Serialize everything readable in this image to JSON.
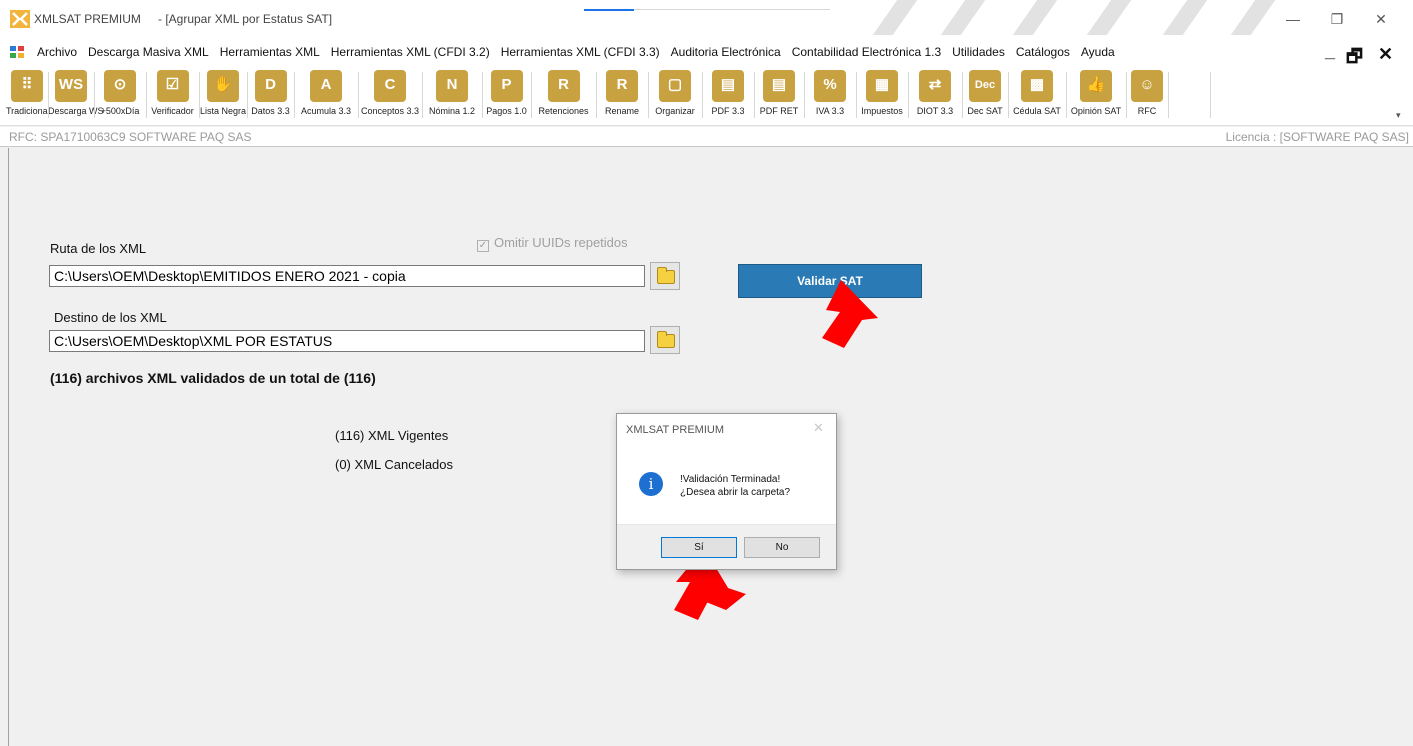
{
  "window": {
    "app_name": "XMLSAT PREMIUM",
    "doc_title": "- [Agrupar  XML por Estatus SAT]",
    "min_glyph": "—",
    "max_glyph": "❐",
    "close_glyph": "✕"
  },
  "menu": {
    "items": [
      "Archivo",
      "Descarga Masiva XML",
      "Herramientas XML",
      "Herramientas XML (CFDI 3.2)",
      "Herramientas XML (CFDI 3.3)",
      "Auditoria Electrónica",
      "Contabilidad Electrónica 1.3",
      "Utilidades",
      "Catálogos",
      "Ayuda"
    ],
    "mdi_min": "_",
    "mdi_max": "🗗",
    "mdi_close": "✕"
  },
  "toolbar": {
    "accent": "#c8a141",
    "buttons": [
      {
        "label": "Tradicional",
        "glyph": "⠿",
        "icon": "grid-icon"
      },
      {
        "label": "Descarga WS",
        "glyph": "WS",
        "icon": "ws-download-icon"
      },
      {
        "label": "+500xDía",
        "glyph": "⊙",
        "icon": "counter-icon"
      },
      {
        "label": "Verificador",
        "glyph": "☑",
        "icon": "checkbox-icon"
      },
      {
        "label": "Lista Negra",
        "glyph": "✋",
        "icon": "hand-icon"
      },
      {
        "label": "Datos 3.3",
        "glyph": "D",
        "icon": "d-xml-icon"
      },
      {
        "label": "Acumula 3.3",
        "glyph": "A",
        "icon": "a-xml-icon"
      },
      {
        "label": "Conceptos 3.3",
        "glyph": "C",
        "icon": "c-xml-icon"
      },
      {
        "label": "Nómina 1.2",
        "glyph": "N",
        "icon": "n-xml-icon"
      },
      {
        "label": "Pagos 1.0",
        "glyph": "P",
        "icon": "p-xml-icon"
      },
      {
        "label": "Retenciones",
        "glyph": "R",
        "icon": "r-xml-icon"
      },
      {
        "label": "Rename",
        "glyph": "R",
        "icon": "rename-icon"
      },
      {
        "label": "Organizar",
        "glyph": "▢",
        "icon": "folder-organize-icon"
      },
      {
        "label": "PDF 3.3",
        "glyph": "▤",
        "icon": "pdf-icon"
      },
      {
        "label": "PDF RET",
        "glyph": "▤",
        "icon": "pdf-ret-icon"
      },
      {
        "label": "IVA 3.3",
        "glyph": "%",
        "icon": "percent-icon"
      },
      {
        "label": "Impuestos",
        "glyph": "▦",
        "icon": "calculator-icon"
      },
      {
        "label": "DIOT 3.3",
        "glyph": "⇄",
        "icon": "handshake-icon"
      },
      {
        "label": "Dec SAT",
        "glyph": "Dec",
        "icon": "dec-icon"
      },
      {
        "label": "Cédula SAT",
        "glyph": "▩",
        "icon": "qr-icon"
      },
      {
        "label": "Opinión SAT",
        "glyph": "👍",
        "icon": "thumbs-up-icon"
      },
      {
        "label": "RFC",
        "glyph": "☺",
        "icon": "person-icon"
      }
    ],
    "grip": "▾"
  },
  "info": {
    "rfc": "RFC: SPA1710063C9 SOFTWARE PAQ SAS",
    "license": "Licencia : [SOFTWARE PAQ SAS]"
  },
  "form": {
    "source_label": "Ruta de los XML",
    "source_path": "C:\\Users\\OEM\\Desktop\\EMITIDOS ENERO 2021 - copia",
    "omit_label": "Omitir UUIDs repetidos",
    "omit_checked": true,
    "dest_label": "Destino de los XML",
    "dest_path": "C:\\Users\\OEM\\Desktop\\XML POR ESTATUS",
    "validate_button": "Validar SAT",
    "validate_color": "#2a7ab5",
    "summary": "(116) archivos XML validados de un total de (116)",
    "vigentes": "(116) XML Vigentes",
    "cancelados": "(0) XML Cancelados"
  },
  "dialog": {
    "title": "XMLSAT PREMIUM",
    "close_glyph": "✕",
    "icon_glyph": "i",
    "message_line1": "!Validación Terminada!",
    "message_line2": "¿Desea abrir la carpeta?",
    "yes": "Sí",
    "no": "No"
  },
  "annotations": {
    "arrow_color": "#ff0000"
  }
}
